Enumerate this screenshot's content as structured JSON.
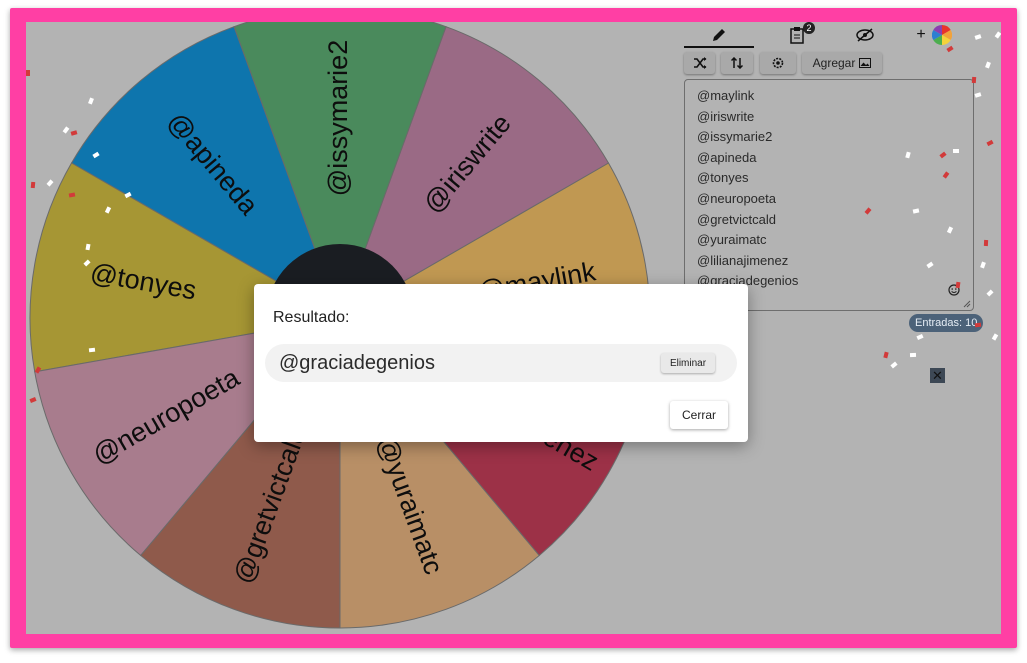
{
  "wheel": {
    "segments": [
      {
        "label": "@maylink",
        "color": "#c09852"
      },
      {
        "label": "@iriswrite",
        "color": "#9a6a85"
      },
      {
        "label": "@issymarie2",
        "color": "#4a8a5c"
      },
      {
        "label": "@apineda",
        "color": "#0e75ad"
      },
      {
        "label": "@tonyes",
        "color": "#a69634"
      },
      {
        "label": "@neuropoeta",
        "color": "#a87c8d"
      },
      {
        "label": "@gretvictcald",
        "color": "#8f5a4b"
      },
      {
        "label": "@yuraimatc",
        "color": "#b88f66"
      },
      {
        "label": "@lilianajimenez",
        "color": "#9c3147"
      }
    ]
  },
  "panel": {
    "tabs": {
      "edit_icon": "pencil-icon",
      "results_icon": "clipboard-icon",
      "results_badge": "2",
      "hide_icon": "eye-off-icon",
      "add": "+"
    },
    "toolbar": {
      "shuffle_icon": "shuffle-icon",
      "sort_icon": "sort-icon",
      "settings_icon": "gear-icon",
      "add_label": "Agregar"
    },
    "entries": [
      "@maylink",
      "@iriswrite",
      "@issymarie2",
      "@apineda",
      "@tonyes",
      "@neuropoeta",
      "@gretvictcald",
      "@yuraimatc",
      "@lilianajimenez",
      "@graciadegenios"
    ],
    "count_label": "Entradas: 10"
  },
  "dialog": {
    "title": "Resultado:",
    "winner": "@graciadegenios",
    "remove_label": "Eliminar",
    "close_label": "Cerrar"
  },
  "colors": {
    "frame": "#ff3fa4",
    "overlay": "#b3b3b3"
  }
}
